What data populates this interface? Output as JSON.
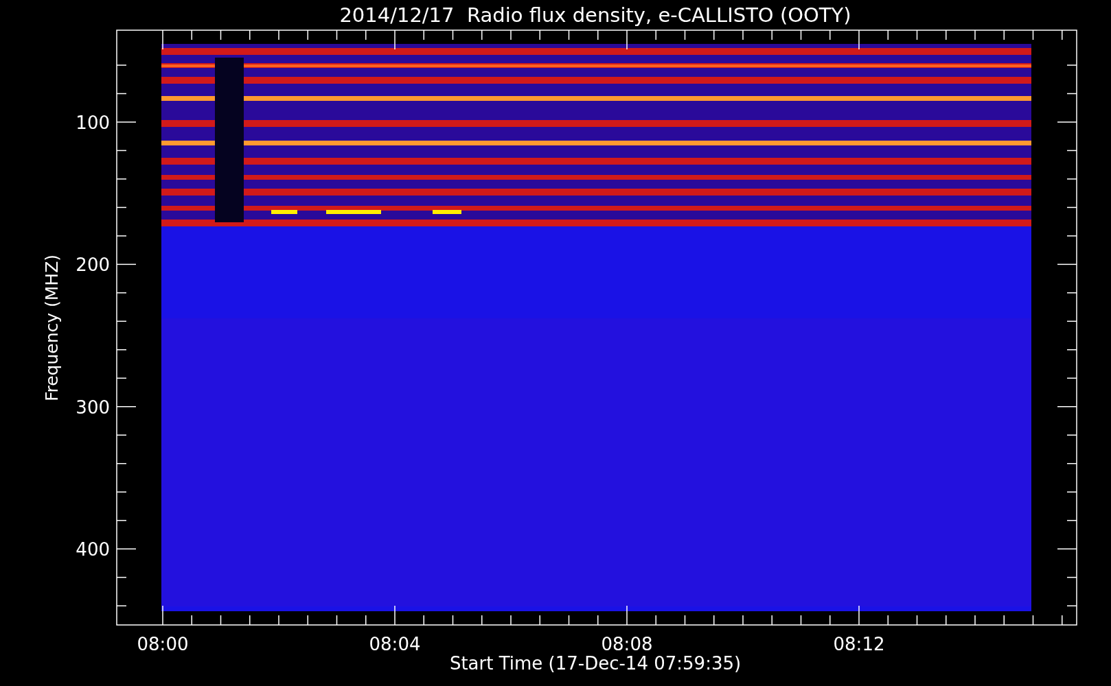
{
  "title": "2014/12/17  Radio flux density, e-CALLISTO (OOTY)",
  "y_axis": {
    "label": "Frequency (MHZ)",
    "ticks": [
      "100",
      "200",
      "300",
      "400"
    ]
  },
  "x_axis": {
    "label": "Start Time (17-Dec-14 07:59:35)",
    "ticks": [
      "08:00",
      "08:04",
      "08:08",
      "08:12"
    ]
  }
}
